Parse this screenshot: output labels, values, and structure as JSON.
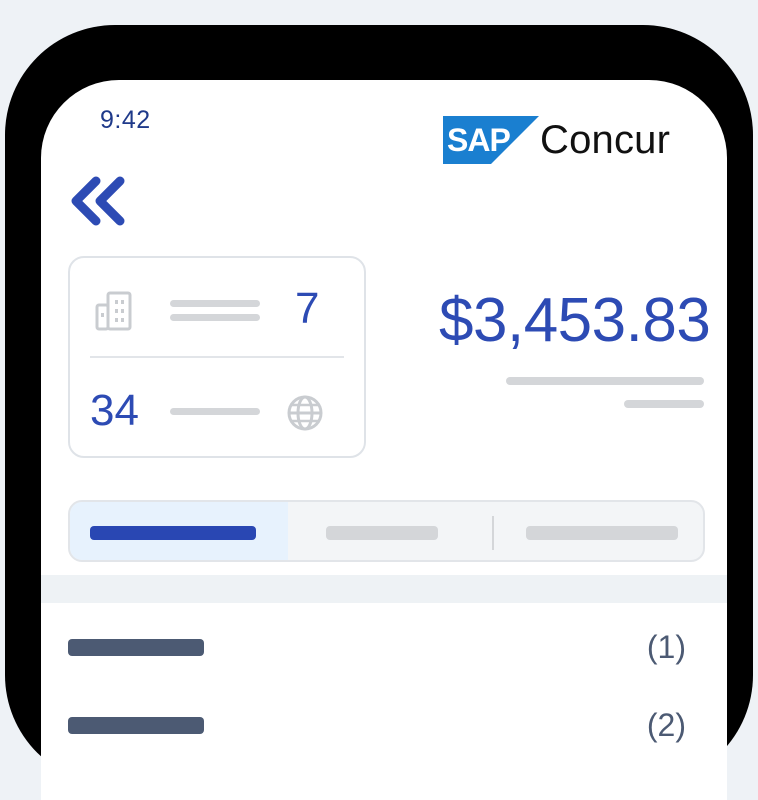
{
  "status_bar": {
    "time": "9:42"
  },
  "brand": {
    "sap": "SAP",
    "name": "Concur"
  },
  "summary": {
    "count_top": "7",
    "count_bottom": "34",
    "amount": "$3,453.83"
  },
  "list": [
    {
      "count": "(1)"
    },
    {
      "count": "(2)"
    }
  ],
  "icons": {
    "back": "double-chevron-left-icon",
    "building": "building-icon",
    "globe": "globe-icon"
  },
  "colors": {
    "accent": "#2d4bb4",
    "sap_blue": "#1a7fd0",
    "placeholder": "#d4d6d9",
    "row_bar": "#4c5a73",
    "active_tab_bg": "#e7f2fd"
  }
}
